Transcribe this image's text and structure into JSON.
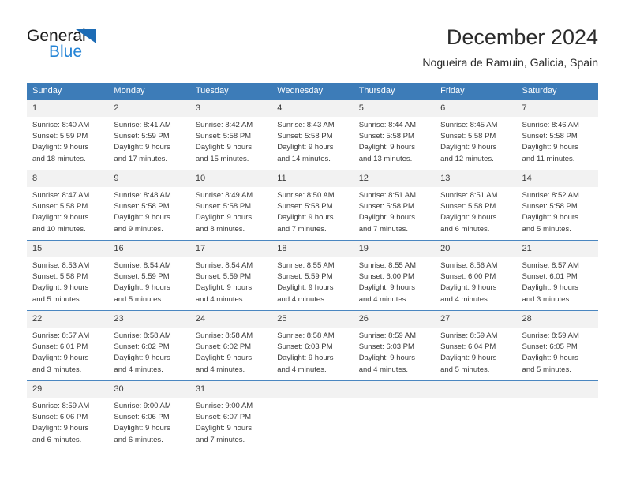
{
  "brand": {
    "name_dark": "General",
    "name_light": "Blue",
    "triangle_color": "#1d6cb5",
    "blue_color": "#2484d6"
  },
  "header": {
    "title": "December 2024",
    "subtitle": "Nogueira de Ramuin, Galicia, Spain"
  },
  "theme": {
    "header_blue": "#3d7cb8",
    "row_divider": "#4a86c0",
    "daynum_bg": "#f2f2f2",
    "text": "#3a3a3a"
  },
  "calendar": {
    "weekday_headers": [
      "Sunday",
      "Monday",
      "Tuesday",
      "Wednesday",
      "Thursday",
      "Friday",
      "Saturday"
    ],
    "weeks": [
      [
        {
          "day": "1",
          "sunrise": "Sunrise: 8:40 AM",
          "sunset": "Sunset: 5:59 PM",
          "daylight_line1": "Daylight: 9 hours",
          "daylight_line2": "and 18 minutes."
        },
        {
          "day": "2",
          "sunrise": "Sunrise: 8:41 AM",
          "sunset": "Sunset: 5:59 PM",
          "daylight_line1": "Daylight: 9 hours",
          "daylight_line2": "and 17 minutes."
        },
        {
          "day": "3",
          "sunrise": "Sunrise: 8:42 AM",
          "sunset": "Sunset: 5:58 PM",
          "daylight_line1": "Daylight: 9 hours",
          "daylight_line2": "and 15 minutes."
        },
        {
          "day": "4",
          "sunrise": "Sunrise: 8:43 AM",
          "sunset": "Sunset: 5:58 PM",
          "daylight_line1": "Daylight: 9 hours",
          "daylight_line2": "and 14 minutes."
        },
        {
          "day": "5",
          "sunrise": "Sunrise: 8:44 AM",
          "sunset": "Sunset: 5:58 PM",
          "daylight_line1": "Daylight: 9 hours",
          "daylight_line2": "and 13 minutes."
        },
        {
          "day": "6",
          "sunrise": "Sunrise: 8:45 AM",
          "sunset": "Sunset: 5:58 PM",
          "daylight_line1": "Daylight: 9 hours",
          "daylight_line2": "and 12 minutes."
        },
        {
          "day": "7",
          "sunrise": "Sunrise: 8:46 AM",
          "sunset": "Sunset: 5:58 PM",
          "daylight_line1": "Daylight: 9 hours",
          "daylight_line2": "and 11 minutes."
        }
      ],
      [
        {
          "day": "8",
          "sunrise": "Sunrise: 8:47 AM",
          "sunset": "Sunset: 5:58 PM",
          "daylight_line1": "Daylight: 9 hours",
          "daylight_line2": "and 10 minutes."
        },
        {
          "day": "9",
          "sunrise": "Sunrise: 8:48 AM",
          "sunset": "Sunset: 5:58 PM",
          "daylight_line1": "Daylight: 9 hours",
          "daylight_line2": "and 9 minutes."
        },
        {
          "day": "10",
          "sunrise": "Sunrise: 8:49 AM",
          "sunset": "Sunset: 5:58 PM",
          "daylight_line1": "Daylight: 9 hours",
          "daylight_line2": "and 8 minutes."
        },
        {
          "day": "11",
          "sunrise": "Sunrise: 8:50 AM",
          "sunset": "Sunset: 5:58 PM",
          "daylight_line1": "Daylight: 9 hours",
          "daylight_line2": "and 7 minutes."
        },
        {
          "day": "12",
          "sunrise": "Sunrise: 8:51 AM",
          "sunset": "Sunset: 5:58 PM",
          "daylight_line1": "Daylight: 9 hours",
          "daylight_line2": "and 7 minutes."
        },
        {
          "day": "13",
          "sunrise": "Sunrise: 8:51 AM",
          "sunset": "Sunset: 5:58 PM",
          "daylight_line1": "Daylight: 9 hours",
          "daylight_line2": "and 6 minutes."
        },
        {
          "day": "14",
          "sunrise": "Sunrise: 8:52 AM",
          "sunset": "Sunset: 5:58 PM",
          "daylight_line1": "Daylight: 9 hours",
          "daylight_line2": "and 5 minutes."
        }
      ],
      [
        {
          "day": "15",
          "sunrise": "Sunrise: 8:53 AM",
          "sunset": "Sunset: 5:58 PM",
          "daylight_line1": "Daylight: 9 hours",
          "daylight_line2": "and 5 minutes."
        },
        {
          "day": "16",
          "sunrise": "Sunrise: 8:54 AM",
          "sunset": "Sunset: 5:59 PM",
          "daylight_line1": "Daylight: 9 hours",
          "daylight_line2": "and 5 minutes."
        },
        {
          "day": "17",
          "sunrise": "Sunrise: 8:54 AM",
          "sunset": "Sunset: 5:59 PM",
          "daylight_line1": "Daylight: 9 hours",
          "daylight_line2": "and 4 minutes."
        },
        {
          "day": "18",
          "sunrise": "Sunrise: 8:55 AM",
          "sunset": "Sunset: 5:59 PM",
          "daylight_line1": "Daylight: 9 hours",
          "daylight_line2": "and 4 minutes."
        },
        {
          "day": "19",
          "sunrise": "Sunrise: 8:55 AM",
          "sunset": "Sunset: 6:00 PM",
          "daylight_line1": "Daylight: 9 hours",
          "daylight_line2": "and 4 minutes."
        },
        {
          "day": "20",
          "sunrise": "Sunrise: 8:56 AM",
          "sunset": "Sunset: 6:00 PM",
          "daylight_line1": "Daylight: 9 hours",
          "daylight_line2": "and 4 minutes."
        },
        {
          "day": "21",
          "sunrise": "Sunrise: 8:57 AM",
          "sunset": "Sunset: 6:01 PM",
          "daylight_line1": "Daylight: 9 hours",
          "daylight_line2": "and 3 minutes."
        }
      ],
      [
        {
          "day": "22",
          "sunrise": "Sunrise: 8:57 AM",
          "sunset": "Sunset: 6:01 PM",
          "daylight_line1": "Daylight: 9 hours",
          "daylight_line2": "and 3 minutes."
        },
        {
          "day": "23",
          "sunrise": "Sunrise: 8:58 AM",
          "sunset": "Sunset: 6:02 PM",
          "daylight_line1": "Daylight: 9 hours",
          "daylight_line2": "and 4 minutes."
        },
        {
          "day": "24",
          "sunrise": "Sunrise: 8:58 AM",
          "sunset": "Sunset: 6:02 PM",
          "daylight_line1": "Daylight: 9 hours",
          "daylight_line2": "and 4 minutes."
        },
        {
          "day": "25",
          "sunrise": "Sunrise: 8:58 AM",
          "sunset": "Sunset: 6:03 PM",
          "daylight_line1": "Daylight: 9 hours",
          "daylight_line2": "and 4 minutes."
        },
        {
          "day": "26",
          "sunrise": "Sunrise: 8:59 AM",
          "sunset": "Sunset: 6:03 PM",
          "daylight_line1": "Daylight: 9 hours",
          "daylight_line2": "and 4 minutes."
        },
        {
          "day": "27",
          "sunrise": "Sunrise: 8:59 AM",
          "sunset": "Sunset: 6:04 PM",
          "daylight_line1": "Daylight: 9 hours",
          "daylight_line2": "and 5 minutes."
        },
        {
          "day": "28",
          "sunrise": "Sunrise: 8:59 AM",
          "sunset": "Sunset: 6:05 PM",
          "daylight_line1": "Daylight: 9 hours",
          "daylight_line2": "and 5 minutes."
        }
      ],
      [
        {
          "day": "29",
          "sunrise": "Sunrise: 8:59 AM",
          "sunset": "Sunset: 6:06 PM",
          "daylight_line1": "Daylight: 9 hours",
          "daylight_line2": "and 6 minutes."
        },
        {
          "day": "30",
          "sunrise": "Sunrise: 9:00 AM",
          "sunset": "Sunset: 6:06 PM",
          "daylight_line1": "Daylight: 9 hours",
          "daylight_line2": "and 6 minutes."
        },
        {
          "day": "31",
          "sunrise": "Sunrise: 9:00 AM",
          "sunset": "Sunset: 6:07 PM",
          "daylight_line1": "Daylight: 9 hours",
          "daylight_line2": "and 7 minutes."
        },
        {
          "day": "",
          "sunrise": "",
          "sunset": "",
          "daylight_line1": "",
          "daylight_line2": ""
        },
        {
          "day": "",
          "sunrise": "",
          "sunset": "",
          "daylight_line1": "",
          "daylight_line2": ""
        },
        {
          "day": "",
          "sunrise": "",
          "sunset": "",
          "daylight_line1": "",
          "daylight_line2": ""
        },
        {
          "day": "",
          "sunrise": "",
          "sunset": "",
          "daylight_line1": "",
          "daylight_line2": ""
        }
      ]
    ]
  }
}
